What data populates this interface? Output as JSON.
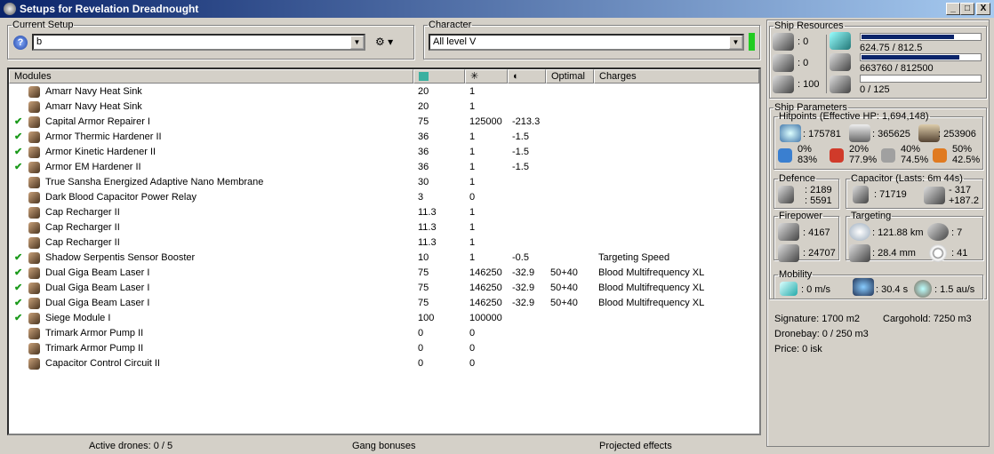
{
  "window": {
    "title": "Setups for Revelation Dreadnought",
    "minimize": "_",
    "maximize": "□",
    "close": "X"
  },
  "setup": {
    "label": "Current Setup",
    "value": "b"
  },
  "character": {
    "label": "Character",
    "value": "All level V",
    "status_color": "#22cc22"
  },
  "table": {
    "headers": [
      "Modules",
      "",
      "",
      "",
      "Optimal",
      "Charges"
    ],
    "rows": [
      {
        "check": false,
        "name": "Amarr Navy Heat Sink",
        "cpu": "20",
        "power": "1",
        "cap": "",
        "optimal": "",
        "charges": ""
      },
      {
        "check": false,
        "name": "Amarr Navy Heat Sink",
        "cpu": "20",
        "power": "1",
        "cap": "",
        "optimal": "",
        "charges": ""
      },
      {
        "check": true,
        "name": "Capital Armor Repairer I",
        "cpu": "75",
        "power": "125000",
        "cap": "-213.3",
        "optimal": "",
        "charges": ""
      },
      {
        "check": true,
        "name": "Armor Thermic Hardener II",
        "cpu": "36",
        "power": "1",
        "cap": "-1.5",
        "optimal": "",
        "charges": ""
      },
      {
        "check": true,
        "name": "Armor Kinetic Hardener II",
        "cpu": "36",
        "power": "1",
        "cap": "-1.5",
        "optimal": "",
        "charges": ""
      },
      {
        "check": true,
        "name": "Armor EM Hardener II",
        "cpu": "36",
        "power": "1",
        "cap": "-1.5",
        "optimal": "",
        "charges": ""
      },
      {
        "check": false,
        "name": "True Sansha Energized Adaptive Nano Membrane",
        "cpu": "30",
        "power": "1",
        "cap": "",
        "optimal": "",
        "charges": ""
      },
      {
        "check": false,
        "name": "Dark Blood Capacitor Power Relay",
        "cpu": "3",
        "power": "0",
        "cap": "",
        "optimal": "",
        "charges": ""
      },
      {
        "check": false,
        "name": "Cap Recharger II",
        "cpu": "11.3",
        "power": "1",
        "cap": "",
        "optimal": "",
        "charges": ""
      },
      {
        "check": false,
        "name": "Cap Recharger II",
        "cpu": "11.3",
        "power": "1",
        "cap": "",
        "optimal": "",
        "charges": ""
      },
      {
        "check": false,
        "name": "Cap Recharger II",
        "cpu": "11.3",
        "power": "1",
        "cap": "",
        "optimal": "",
        "charges": ""
      },
      {
        "check": true,
        "name": "Shadow Serpentis Sensor Booster",
        "cpu": "10",
        "power": "1",
        "cap": "-0.5",
        "optimal": "",
        "charges": "Targeting Speed"
      },
      {
        "check": true,
        "name": "Dual Giga Beam Laser I",
        "cpu": "75",
        "power": "146250",
        "cap": "-32.9",
        "optimal": "50+40",
        "charges": "Blood Multifrequency XL"
      },
      {
        "check": true,
        "name": "Dual Giga Beam Laser I",
        "cpu": "75",
        "power": "146250",
        "cap": "-32.9",
        "optimal": "50+40",
        "charges": "Blood Multifrequency XL"
      },
      {
        "check": true,
        "name": "Dual Giga Beam Laser I",
        "cpu": "75",
        "power": "146250",
        "cap": "-32.9",
        "optimal": "50+40",
        "charges": "Blood Multifrequency XL"
      },
      {
        "check": true,
        "name": "Siege Module I",
        "cpu": "100",
        "power": "100000",
        "cap": "",
        "optimal": "",
        "charges": ""
      },
      {
        "check": false,
        "name": "Trimark Armor Pump II",
        "cpu": "0",
        "power": "0",
        "cap": "",
        "optimal": "",
        "charges": ""
      },
      {
        "check": false,
        "name": "Trimark Armor Pump II",
        "cpu": "0",
        "power": "0",
        "cap": "",
        "optimal": "",
        "charges": ""
      },
      {
        "check": false,
        "name": "Capacitor Control Circuit II",
        "cpu": "0",
        "power": "0",
        "cap": "",
        "optimal": "",
        "charges": ""
      }
    ]
  },
  "status": {
    "drones": "Active drones: 0 / 5",
    "gang": "Gang bonuses",
    "projected": "Projected effects"
  },
  "resources": {
    "label": "Ship Resources",
    "turrets": ": 0",
    "launchers": ": 0",
    "calibration": ": 100",
    "cpu": "624.75 / 812.5",
    "cpu_fraction": 0.769,
    "power": "663760 / 812500",
    "power_fraction": 0.817,
    "drone": "0 / 125",
    "drone_fraction": 0
  },
  "params": {
    "label": "Ship Parameters",
    "hp_label": "Hitpoints (Effective HP: 1,694,148)",
    "shield": ": 175781",
    "armor": ": 365625",
    "structure": ": 253906",
    "resists": [
      {
        "top": "0%",
        "bottom": "83%",
        "color": "#3a7fd0"
      },
      {
        "top": "20%",
        "bottom": "77.9%",
        "color": "#d03a2a"
      },
      {
        "top": "40%",
        "bottom": "74.5%",
        "color": "#a0a0a0"
      },
      {
        "top": "50%",
        "bottom": "42.5%",
        "color": "#e07a20"
      }
    ],
    "defence_label": "Defence",
    "defence1": ": 2189",
    "defence2": ": 5591",
    "cap_label": "Capacitor (Lasts: 6m 44s)",
    "cap_amount": ": 71719",
    "cap_use": "- 317",
    "cap_regen": "+187.2",
    "fire_label": "Firepower",
    "fire1": ": 4167",
    "fire2": ": 24707",
    "target_label": "Targeting",
    "range": ": 121.88 km",
    "targets": ": 7",
    "sensor": ": 28.4 mm",
    "scanres": ": 41",
    "mobility_label": "Mobility",
    "speed": ": 0 m/s",
    "align": ": 30.4 s",
    "warp": ": 1.5 au/s",
    "signature": "Signature: 1700 m2",
    "cargo": "Cargohold: 7250 m3",
    "dronebay": "Dronebay: 0 / 250 m3",
    "price": "Price: 0 isk"
  }
}
